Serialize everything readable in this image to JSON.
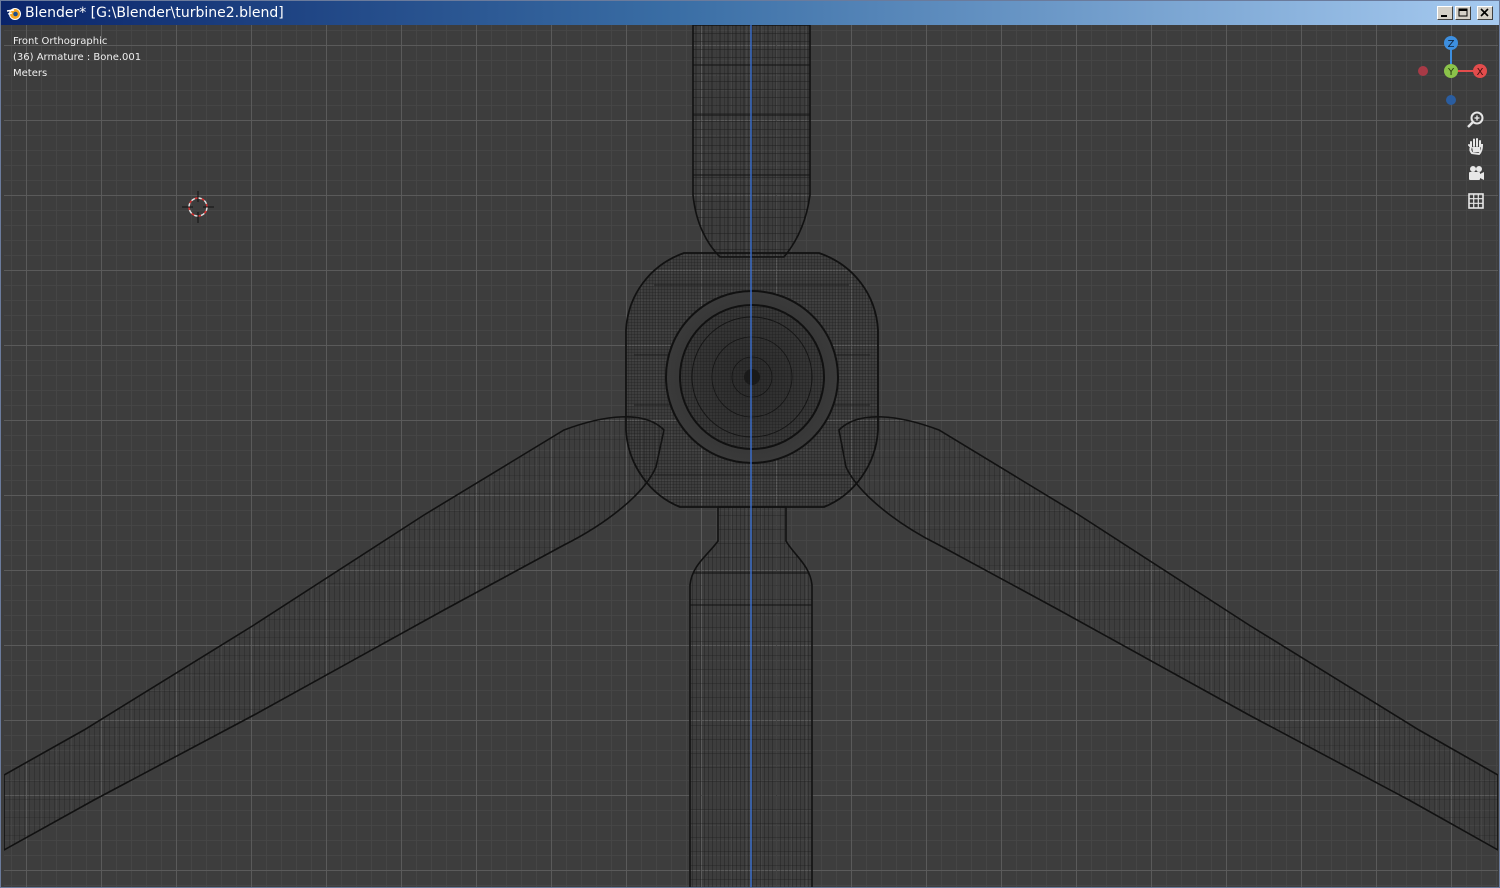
{
  "window": {
    "title": "Blender* [G:\\Blender\\turbine2.blend]",
    "buttons": [
      "minimize",
      "maximize",
      "close"
    ]
  },
  "viewport": {
    "view_name": "Front Orthographic",
    "active_object": "(36) Armature : Bone.001",
    "units": "Meters",
    "shading": "wireframe",
    "grid": true
  },
  "axis_gizmo": {
    "z_label": "Z",
    "y_label": "Y",
    "x_label": "X",
    "colors": {
      "x": "#e34c4c",
      "y": "#8bc34a",
      "z": "#3d8fe0",
      "neg_x": "#a83a46",
      "neg_z": "#2a5da0"
    }
  },
  "nav_tools": [
    "zoom-icon",
    "pan-hand-icon",
    "camera-icon",
    "ortho-grid-icon"
  ],
  "colors": {
    "background": "#3d3d3d",
    "wire": "#111111",
    "axis_line": "#3a6fd1",
    "cursor": "#e0e0e0"
  }
}
